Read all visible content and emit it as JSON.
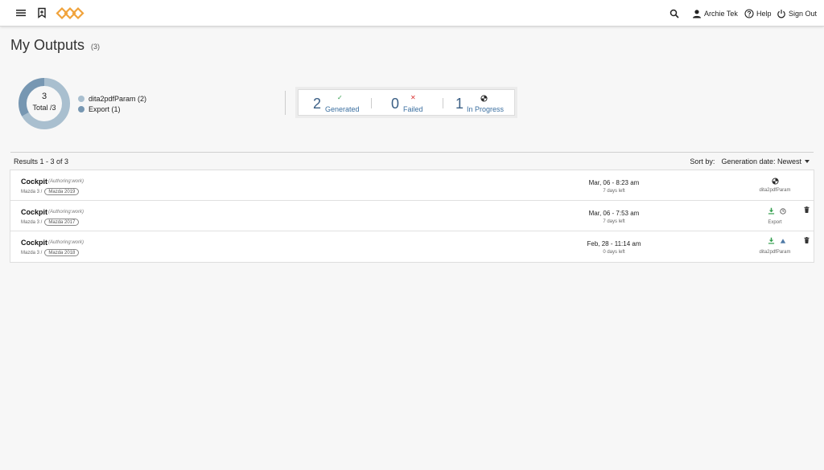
{
  "header": {
    "user_name": "Archie Tek",
    "help_label": "Help",
    "signout_label": "Sign Out",
    "icons": [
      "menu-icon",
      "bookmark-icon",
      "search-icon",
      "user-icon",
      "help-icon",
      "power-icon"
    ],
    "logo_color": "#f0a23a"
  },
  "page": {
    "title": "My Outputs",
    "count": "(3)"
  },
  "summary": {
    "total_value": "3",
    "total_label": "Total /3",
    "legend": [
      {
        "label": "dita2pdfParam (2)",
        "color": "#a9bfcf",
        "value": 2
      },
      {
        "label": "Export (1)",
        "color": "#7797b2",
        "value": 1
      }
    ]
  },
  "status": {
    "generated": {
      "value": "2",
      "label": "Generated",
      "icon": "check-icon",
      "color": "#2e9c4a"
    },
    "failed": {
      "value": "0",
      "label": "Failed",
      "icon": "x-icon",
      "color": "#d93030"
    },
    "in_progress": {
      "value": "1",
      "label": "In Progress",
      "icon": "progress-icon",
      "color": "#222222"
    }
  },
  "results": {
    "text": "Results 1 - 3 of 3",
    "sort_label": "Sort by:",
    "sort_value": "Generation date: Newest"
  },
  "rows": [
    {
      "title": "Cockpit",
      "context": "(Authoring:work)",
      "crumb": "Mazda 3 /",
      "tag": "Mazda 2019",
      "date": "Mar, 06 - 8:23 am",
      "left": "7 days left",
      "output": "dita2pdfParam",
      "status": "in-progress",
      "actions": [
        "progress-icon"
      ],
      "deletable": false
    },
    {
      "title": "Cockpit",
      "context": "(Authoring:work)",
      "crumb": "Mazda 3 /",
      "tag": "Mazda 2017",
      "date": "Mar, 06 - 7:53 am",
      "left": "7 days left",
      "output": "Export",
      "status": "generated",
      "actions": [
        "download-icon",
        "clock-icon"
      ],
      "deletable": true
    },
    {
      "title": "Cockpit",
      "context": "(Authoring:work)",
      "crumb": "Mazda 3 /",
      "tag": "Mazda 2018",
      "date": "Feb, 28 - 11:14 am",
      "left": "0 days left",
      "output": "dita2pdfParam",
      "status": "generated",
      "actions": [
        "download-icon",
        "warning-icon"
      ],
      "deletable": true
    }
  ]
}
